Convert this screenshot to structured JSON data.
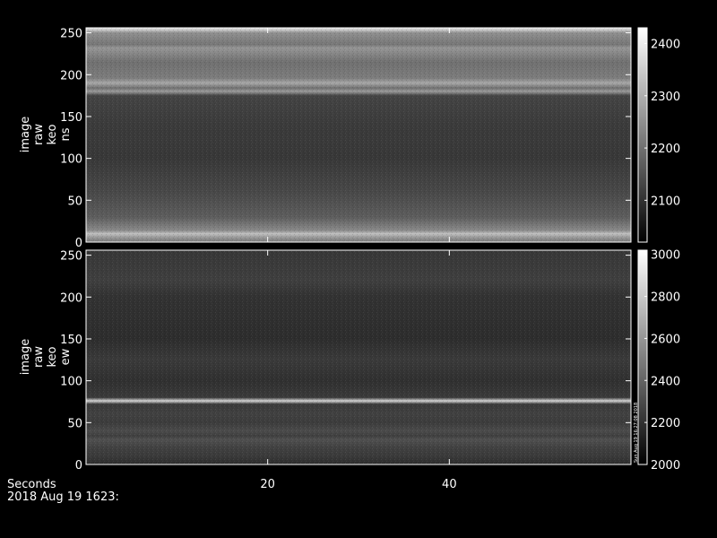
{
  "chart_data": [
    {
      "type": "heatmap",
      "panel": "ns",
      "ylabel_lines": [
        "image",
        "raw",
        "keo",
        "ns"
      ],
      "ylim": [
        0,
        256
      ],
      "xlim": [
        0,
        60
      ],
      "y_ticks": [
        0,
        50,
        100,
        150,
        200,
        250
      ],
      "x_ticks": [
        20,
        40
      ],
      "colorbar_range": [
        2020,
        2430
      ],
      "colorbar_ticks": [
        2100,
        2200,
        2300,
        2400
      ],
      "base_color": "#2c2c2c",
      "row_profile": [
        {
          "y": 0,
          "value": 2210
        },
        {
          "y": 6,
          "value": 2270
        },
        {
          "y": 10,
          "value": 2330
        },
        {
          "y": 14,
          "value": 2240
        },
        {
          "y": 30,
          "value": 2170
        },
        {
          "y": 60,
          "value": 2135
        },
        {
          "y": 100,
          "value": 2110
        },
        {
          "y": 140,
          "value": 2115
        },
        {
          "y": 175,
          "value": 2130
        },
        {
          "y": 180,
          "value": 2270
        },
        {
          "y": 184,
          "value": 2200
        },
        {
          "y": 190,
          "value": 2290
        },
        {
          "y": 196,
          "value": 2220
        },
        {
          "y": 215,
          "value": 2200
        },
        {
          "y": 232,
          "value": 2260
        },
        {
          "y": 236,
          "value": 2210
        },
        {
          "y": 250,
          "value": 2250
        },
        {
          "y": 254,
          "value": 2360
        }
      ]
    },
    {
      "type": "heatmap",
      "panel": "ew",
      "ylabel_lines": [
        "image",
        "raw",
        "keo",
        "ew"
      ],
      "ylim": [
        0,
        256
      ],
      "xlim": [
        0,
        60
      ],
      "y_ticks": [
        0,
        50,
        100,
        150,
        200,
        250
      ],
      "x_ticks": [
        20,
        40
      ],
      "colorbar_range": [
        2000,
        3020
      ],
      "colorbar_ticks": [
        2000,
        2200,
        2400,
        2600,
        2800,
        3000
      ],
      "base_color": "#1e1e1e",
      "row_profile": [
        {
          "y": 0,
          "value": 2180
        },
        {
          "y": 10,
          "value": 2230
        },
        {
          "y": 20,
          "value": 2260
        },
        {
          "y": 30,
          "value": 2320
        },
        {
          "y": 34,
          "value": 2250
        },
        {
          "y": 40,
          "value": 2300
        },
        {
          "y": 50,
          "value": 2240
        },
        {
          "y": 60,
          "value": 2260
        },
        {
          "y": 72,
          "value": 2230
        },
        {
          "y": 76,
          "value": 2850
        },
        {
          "y": 80,
          "value": 2230
        },
        {
          "y": 100,
          "value": 2190
        },
        {
          "y": 125,
          "value": 2230
        },
        {
          "y": 150,
          "value": 2180
        },
        {
          "y": 200,
          "value": 2200
        },
        {
          "y": 220,
          "value": 2250
        },
        {
          "y": 240,
          "value": 2230
        },
        {
          "y": 256,
          "value": 2220
        }
      ]
    }
  ],
  "footer": {
    "xlabel": "Seconds",
    "date_label": "2018 Aug 19 1623:"
  },
  "stamp_text": "Sun Aug 19 16:27:08 2018"
}
